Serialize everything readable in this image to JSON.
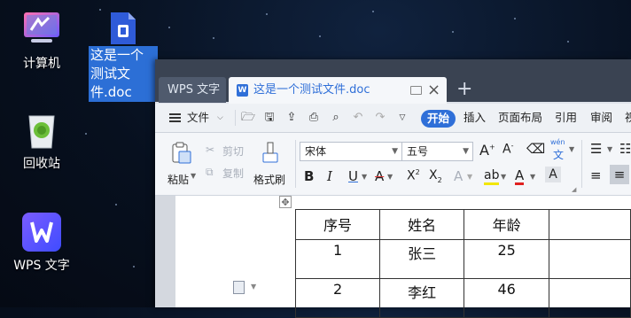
{
  "desktop": {
    "icons": [
      {
        "label": "计算机",
        "icon": "computer-icon"
      },
      {
        "label": "回收站",
        "icon": "recycle-bin-icon"
      },
      {
        "label": "WPS 文字",
        "icon": "wps-writer-icon"
      }
    ],
    "selected_file": {
      "label": "这是一个测试文件.doc",
      "icon": "doc-file-icon"
    }
  },
  "window": {
    "tabs": [
      {
        "label": "WPS 文字"
      },
      {
        "label": "这是一个测试文件.doc",
        "active": true
      }
    ],
    "new_tab_icon": "plus-icon",
    "menu": {
      "file_label": "文件",
      "items": [
        "开始",
        "插入",
        "页面布局",
        "引用",
        "审阅",
        "视"
      ],
      "active": "开始"
    },
    "ribbon": {
      "paste_label": "粘贴",
      "cut_label": "剪切",
      "copy_label": "复制",
      "format_painter_label": "格式刷",
      "font_name": "宋体",
      "font_size": "五号",
      "phonetic_label": "wén"
    },
    "document": {
      "table": {
        "headers": [
          "序号",
          "姓名",
          "年龄"
        ],
        "rows": [
          [
            "1",
            "张三",
            "25"
          ],
          [
            "2",
            "李红",
            "46"
          ]
        ]
      }
    }
  },
  "colors": {
    "accent": "#2f6fd8",
    "tab_bar": "#3a4352",
    "selection": "#2c6fd6"
  }
}
